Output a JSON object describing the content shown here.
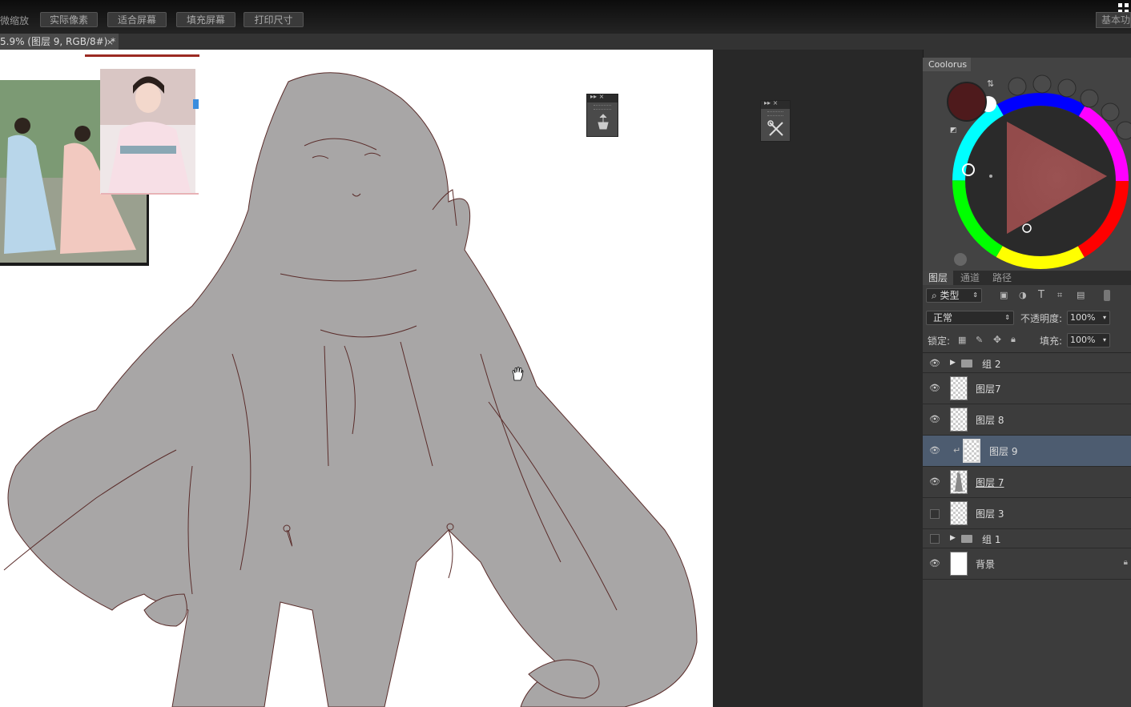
{
  "toolbar": {
    "left_label": "微缩放",
    "buttons": [
      "实际像素",
      "适合屏幕",
      "填充屏幕",
      "打印尺寸"
    ],
    "workspace": "基本功能"
  },
  "document": {
    "tab_title": "5.9% (图层 9, RGB/8#) *",
    "close": "×"
  },
  "float_palettes": [
    {
      "header": "▸▸ ×",
      "icon": "brush-presets-icon"
    },
    {
      "header": "▸▸ ×",
      "icon": "tools-icon"
    }
  ],
  "coolorus": {
    "title": "Coolorus",
    "foreground": "#4e1a1c",
    "background": "#ffffff"
  },
  "panels": {
    "tabs": [
      "图层",
      "通道",
      "路径"
    ]
  },
  "layers_panel": {
    "filter_type": "类型",
    "blend_mode": "正常",
    "opacity_label": "不透明度:",
    "opacity_value": "100%",
    "lock_label": "锁定:",
    "fill_label": "填充:",
    "fill_value": "100%",
    "layers": [
      {
        "name": "组 2",
        "kind": "group",
        "visible": true
      },
      {
        "name": "图层7",
        "kind": "layer",
        "visible": true
      },
      {
        "name": "图层 8",
        "kind": "layer",
        "visible": true
      },
      {
        "name": "图层 9",
        "kind": "clip",
        "visible": true,
        "selected": true
      },
      {
        "name": "图层 7",
        "kind": "layer",
        "visible": true
      },
      {
        "name": "图层 3",
        "kind": "layer",
        "visible": false
      },
      {
        "name": "组 1",
        "kind": "group",
        "visible": false
      },
      {
        "name": "背景",
        "kind": "background",
        "visible": true,
        "locked": true
      }
    ]
  }
}
